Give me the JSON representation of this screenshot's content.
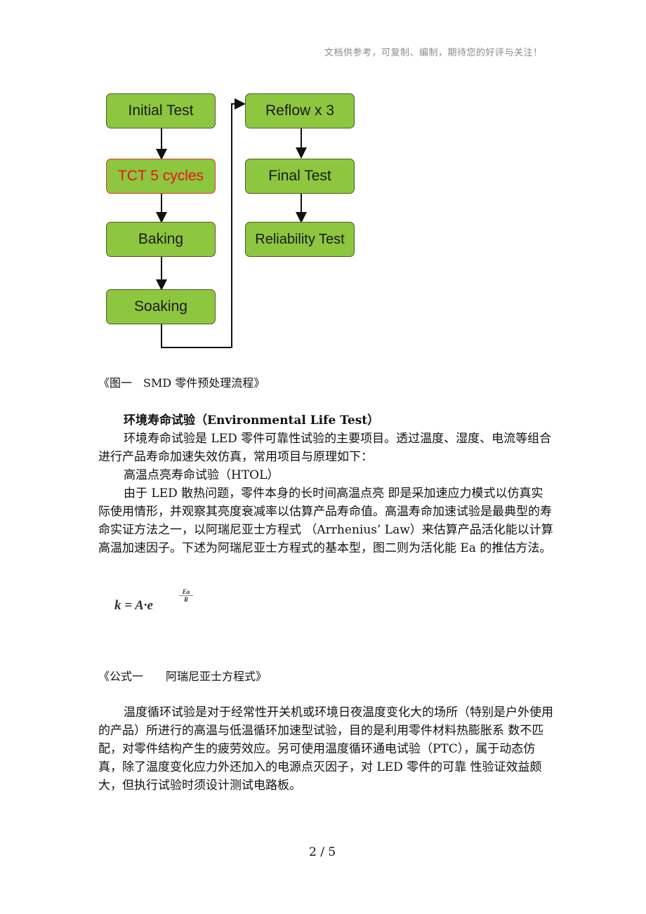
{
  "header_note": "文档供参考，可复制、编制，期待您的好评与关注！",
  "flowchart": {
    "nodes": [
      {
        "label": "Initial Test",
        "highlight": false
      },
      {
        "label": "TCT 5 cycles",
        "highlight": true
      },
      {
        "label": "Baking",
        "highlight": false
      },
      {
        "label": "Soaking",
        "highlight": false
      },
      {
        "label": "Reflow x 3",
        "highlight": false
      },
      {
        "label": "Final Test",
        "highlight": false
      },
      {
        "label": "Reliability Test",
        "highlight": false
      }
    ],
    "colors": {
      "node_fill": "#8dc63f",
      "node_border": "#4b5d2a",
      "highlight_text": "#e8141a",
      "highlight_border": "#e53a2a"
    }
  },
  "figure_caption": "《图一　SMD 零件预处理流程》",
  "section": {
    "heading": "环境寿命试验（Environmental Life Test）",
    "intro": "环境寿命试验是 LED 零件可靠性试验的主要项目。透过温度、湿度、电流等组合进行产品寿命加速失效仿真，常用项目与原理如下：",
    "sub_heading": "高温点亮寿命试验（HTOL）",
    "htol_paragraph": "由于 LED 散热问题，零件本身的长时间高温点亮 即是采加速应力模式以仿真实际使用情形，并观察其亮度衰减率以估算产品寿命值。高温寿命加速试验是最典型的寿命实证方法之一，以阿瑞尼亚士方程式 （Arrhenius’ Law）来估算产品活化能以计算高温加速因子。下述为阿瑞尼亚士方程式的基本型，图二则为活化能 Ea 的推估方法。"
  },
  "formula": {
    "base": "k = A·e",
    "exp_num": "Ea",
    "exp_den": "R"
  },
  "formula_caption": "《公式一　　阿瑞尼亚士方程式》",
  "tct_paragraph": "温度循环试验是对于经常性开关机或环境日夜温度变化大的场所（特别是户外使用的产品）所进行的高温与低温循环加速型试验，目的是利用零件材料热膨胀系 数不匹配，对零件结构产生的疲劳效应。另可使用温度循环通电试验（PTC），属于动态仿真，除了温度变化应力外还加入的电源点灭因子，对 LED 零件的可靠 性验证效益颇大，但执行试验时须设计测试电路板。",
  "page_number": "2 / 5"
}
